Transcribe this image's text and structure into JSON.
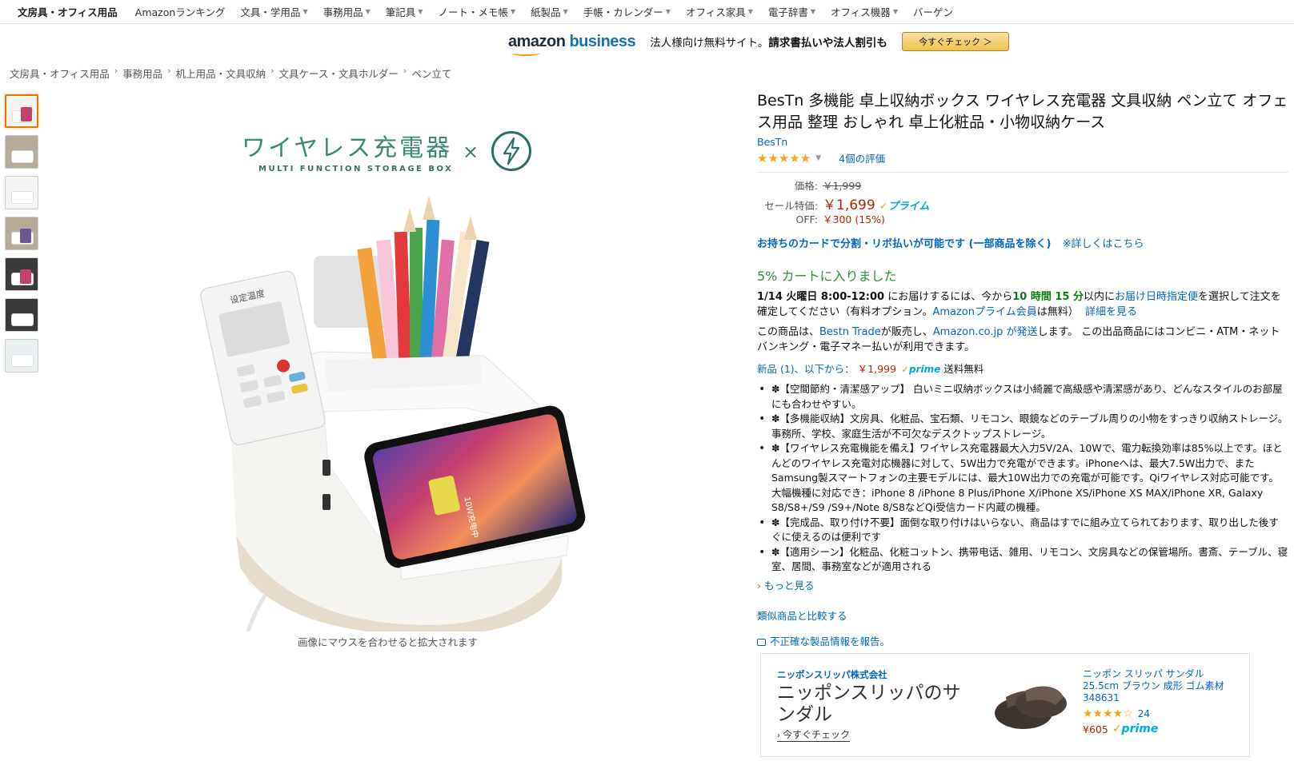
{
  "subnav": {
    "first": "文房具・オフィス用品",
    "items": [
      "Amazonランキング",
      "文具・学用品",
      "事務用品",
      "筆記具",
      "ノート・メモ帳",
      "紙製品",
      "手帳・カレンダー",
      "オフィス家具",
      "電子辞書",
      "オフィス機器",
      "バーゲン"
    ],
    "has_caret": [
      false,
      true,
      true,
      true,
      true,
      true,
      true,
      true,
      true,
      true,
      false
    ]
  },
  "business_banner": {
    "logo_amazon": "amazon",
    "logo_business": "business",
    "text_plain": "法人様向け無料サイト。",
    "text_bold": "請求書払いや法人割引も",
    "button": "今すぐチェック ＞"
  },
  "breadcrumb": [
    "文房具・オフィス用品",
    "事務用品",
    "机上用品・文具収納",
    "文具ケース・文具ホルダー",
    "ペン立て"
  ],
  "hero": {
    "title": "ワイヤレス充電器",
    "subtitle": "MULTI FUNCTION STORAGE BOX",
    "times": "×",
    "remote_label": "设定温度",
    "phone_screen_text": "10W充电中",
    "caption": "画像にマウスを合わせると拡大されます"
  },
  "product": {
    "title": "BesTn 多機能 卓上収納ボックス ワイヤレス充電器 文具収納 ペン立て オフェス用品 整理 おしゃれ 卓上化粧品・小物収納ケース",
    "brand": "BesTn",
    "stars": "★★★★★",
    "review_count": "4個の評価",
    "price_label": "価格:",
    "list_price": "￥1,999",
    "sale_label": "セール特価:",
    "sale_price": "￥1,699",
    "prime_label": "プライム",
    "off_label": "OFF:",
    "off_value": "￥300 (15%)",
    "card_strong": "お持ちのカードで分割・リボ払いが可能です (一部商品を除く)",
    "card_detail": "※詳しくはこちら",
    "cart_message": "5% カートに入りました",
    "delivery": {
      "date": "1/14 火曜日 8:00-12:00",
      "t1": " にお届けするには、今から",
      "time": "10 時間 15 分",
      "t2": "以内に",
      "link1": "お届け日時指定便",
      "t3": "を選択して注文を確定してください（有料オプション。",
      "link2": "Amazonプライム会員",
      "t4": "は無料）",
      "link3": "詳細を見る"
    },
    "seller": {
      "t1": "この商品は、",
      "link1": "Bestn Trade",
      "t2": "が販売し、",
      "link2": "Amazon.co.jp が発送",
      "t3": "します。 この出品商品にはコンビニ・ATM・ネットバンキング・電子マネー払いが利用できます。"
    },
    "new_offers": {
      "link": "新品 (1)、以下から：",
      "price": "￥1,999",
      "prime": "prime",
      "shipping": "送料無料"
    },
    "bullets": [
      "✽【空間節約・清潔感アップ】 白いミニ収納ボックスは小綺麗で高級感や清潔感があり、どんなスタイルのお部屋にも合わせやすい。",
      "✽【多機能収納】文房具、化粧品、宝石類、リモコン、眼鏡などのテーブル周りの小物をすっきり収納ストレージ。事務所、学校、家庭生活が不可欠なデスクトップストレージ。",
      "✽【ワイヤレス充電機能を備え】ワイヤレス充電器最大入力5V/2A、10Wで、電力転換効率は85%以上です。ほとんどのワイヤレス充電対応機器に対して、5W出力で充電ができます。iPhoneへは、最大7.5W出力で、またSamsung製スマートフォンの主要モデルには、最大10W出力での充電が可能です。Qiワイヤレス対応可能です。大幅機種に対応でき：iPhone 8 /iPhone 8 Plus/iPhone X/iPhone XS/iPhone XS MAX/iPhone XR, Galaxy S8/S8+/S9 /S9+/Note 8/S8などQi受信カード内蔵の機種。",
      "✽【完成品、取り付け不要】面倒な取り付けはいらない、商品はすでに組み立てられております、取り出した後すぐに使えるのは便利です",
      "✽【適用シーン】化粧品、化粧コットン、携带电话、雑用、リモコン、文房具などの保管場所。書斎、テーブル、寝室、居間、事務室などが適用される"
    ],
    "more": "もっと見る",
    "compare": "類似商品と比較する",
    "report": "不正確な製品情報を報告。"
  },
  "ad": {
    "company": "ニッポンスリッパ株式会社",
    "headline": "ニッポンスリッパのサンダル",
    "cta": "今すぐチェック",
    "product_name": "ニッポン スリッパ サンダル 25.5cm ブラウン 成形 ゴム素材 348631",
    "stars": "★★★★☆",
    "count": "24",
    "price": "¥605",
    "prime": "prime"
  },
  "colors": {
    "link": "#0066c0",
    "price": "#b12704",
    "prime": "#00a8e1",
    "star": "#f4a41d",
    "cart_green": "#2f8d3a",
    "button_gold": "#f0c14b"
  }
}
